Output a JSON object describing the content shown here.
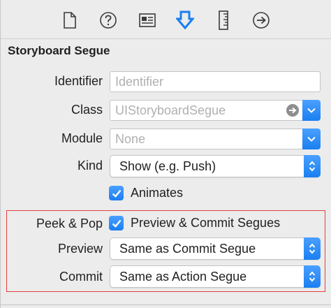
{
  "toolbar": {
    "icons": [
      "file-inspector-icon",
      "quick-help-icon",
      "identity-inspector-icon",
      "attributes-inspector-icon",
      "size-inspector-icon",
      "connections-inspector-icon"
    ],
    "active_color": "#1a7ff0"
  },
  "section": {
    "title": "Storyboard Segue"
  },
  "fields": {
    "identifier": {
      "label": "Identifier",
      "placeholder": "Identifier",
      "value": ""
    },
    "class": {
      "label": "Class",
      "placeholder": "UIStoryboardSegue",
      "value": ""
    },
    "module": {
      "label": "Module",
      "placeholder": "None",
      "value": ""
    },
    "kind": {
      "label": "Kind",
      "value": "Show (e.g. Push)"
    },
    "animates": {
      "label": "Animates",
      "checked": true
    },
    "peek_pop": {
      "label": "Peek & Pop",
      "checkbox_label": "Preview & Commit Segues",
      "checked": true
    },
    "preview": {
      "label": "Preview",
      "value": "Same as Commit Segue"
    },
    "commit": {
      "label": "Commit",
      "value": "Same as Action Segue"
    }
  },
  "colors": {
    "accent": "#1a7ff0",
    "highlight_border": "#e0403f",
    "background": "#ececec"
  }
}
